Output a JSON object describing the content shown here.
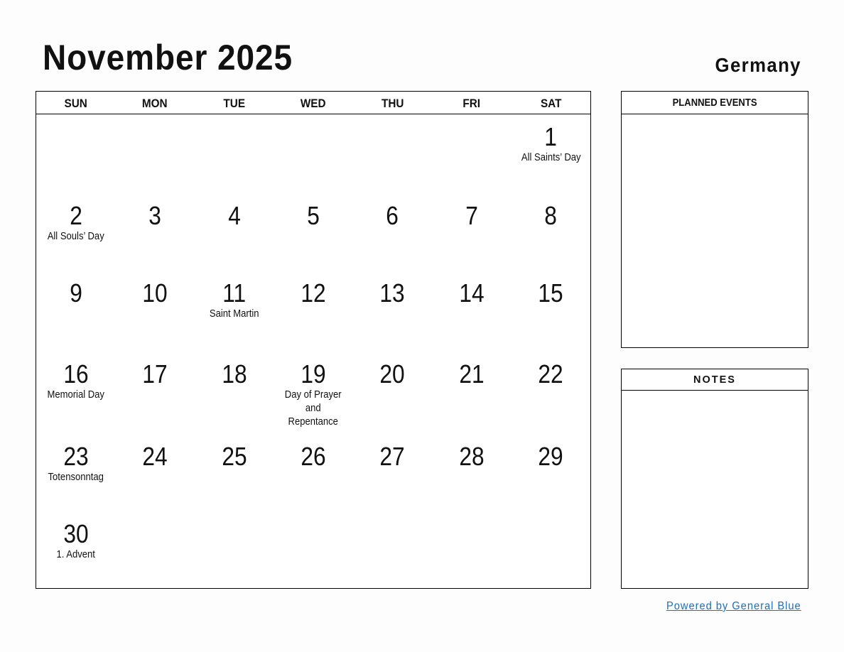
{
  "header": {
    "title": "November 2025",
    "country": "Germany"
  },
  "calendar": {
    "weekdays": [
      "SUN",
      "MON",
      "TUE",
      "WED",
      "THU",
      "FRI",
      "SAT"
    ],
    "first_weekday_index": 6,
    "days_in_month": 30,
    "holidays": {
      "1": "All Saints’ Day",
      "2": "All Souls’ Day",
      "11": "Saint Martin",
      "16": "Memorial Day",
      "19": "Day of Prayer and Repentance",
      "23": "Totensonntag",
      "30": "1. Advent"
    }
  },
  "side": {
    "planned_events_label": "PLANNED EVENTS",
    "notes_label": "NOTES"
  },
  "footer": {
    "powered_by": "Powered by General Blue",
    "link_color": "#1f6fc0"
  }
}
